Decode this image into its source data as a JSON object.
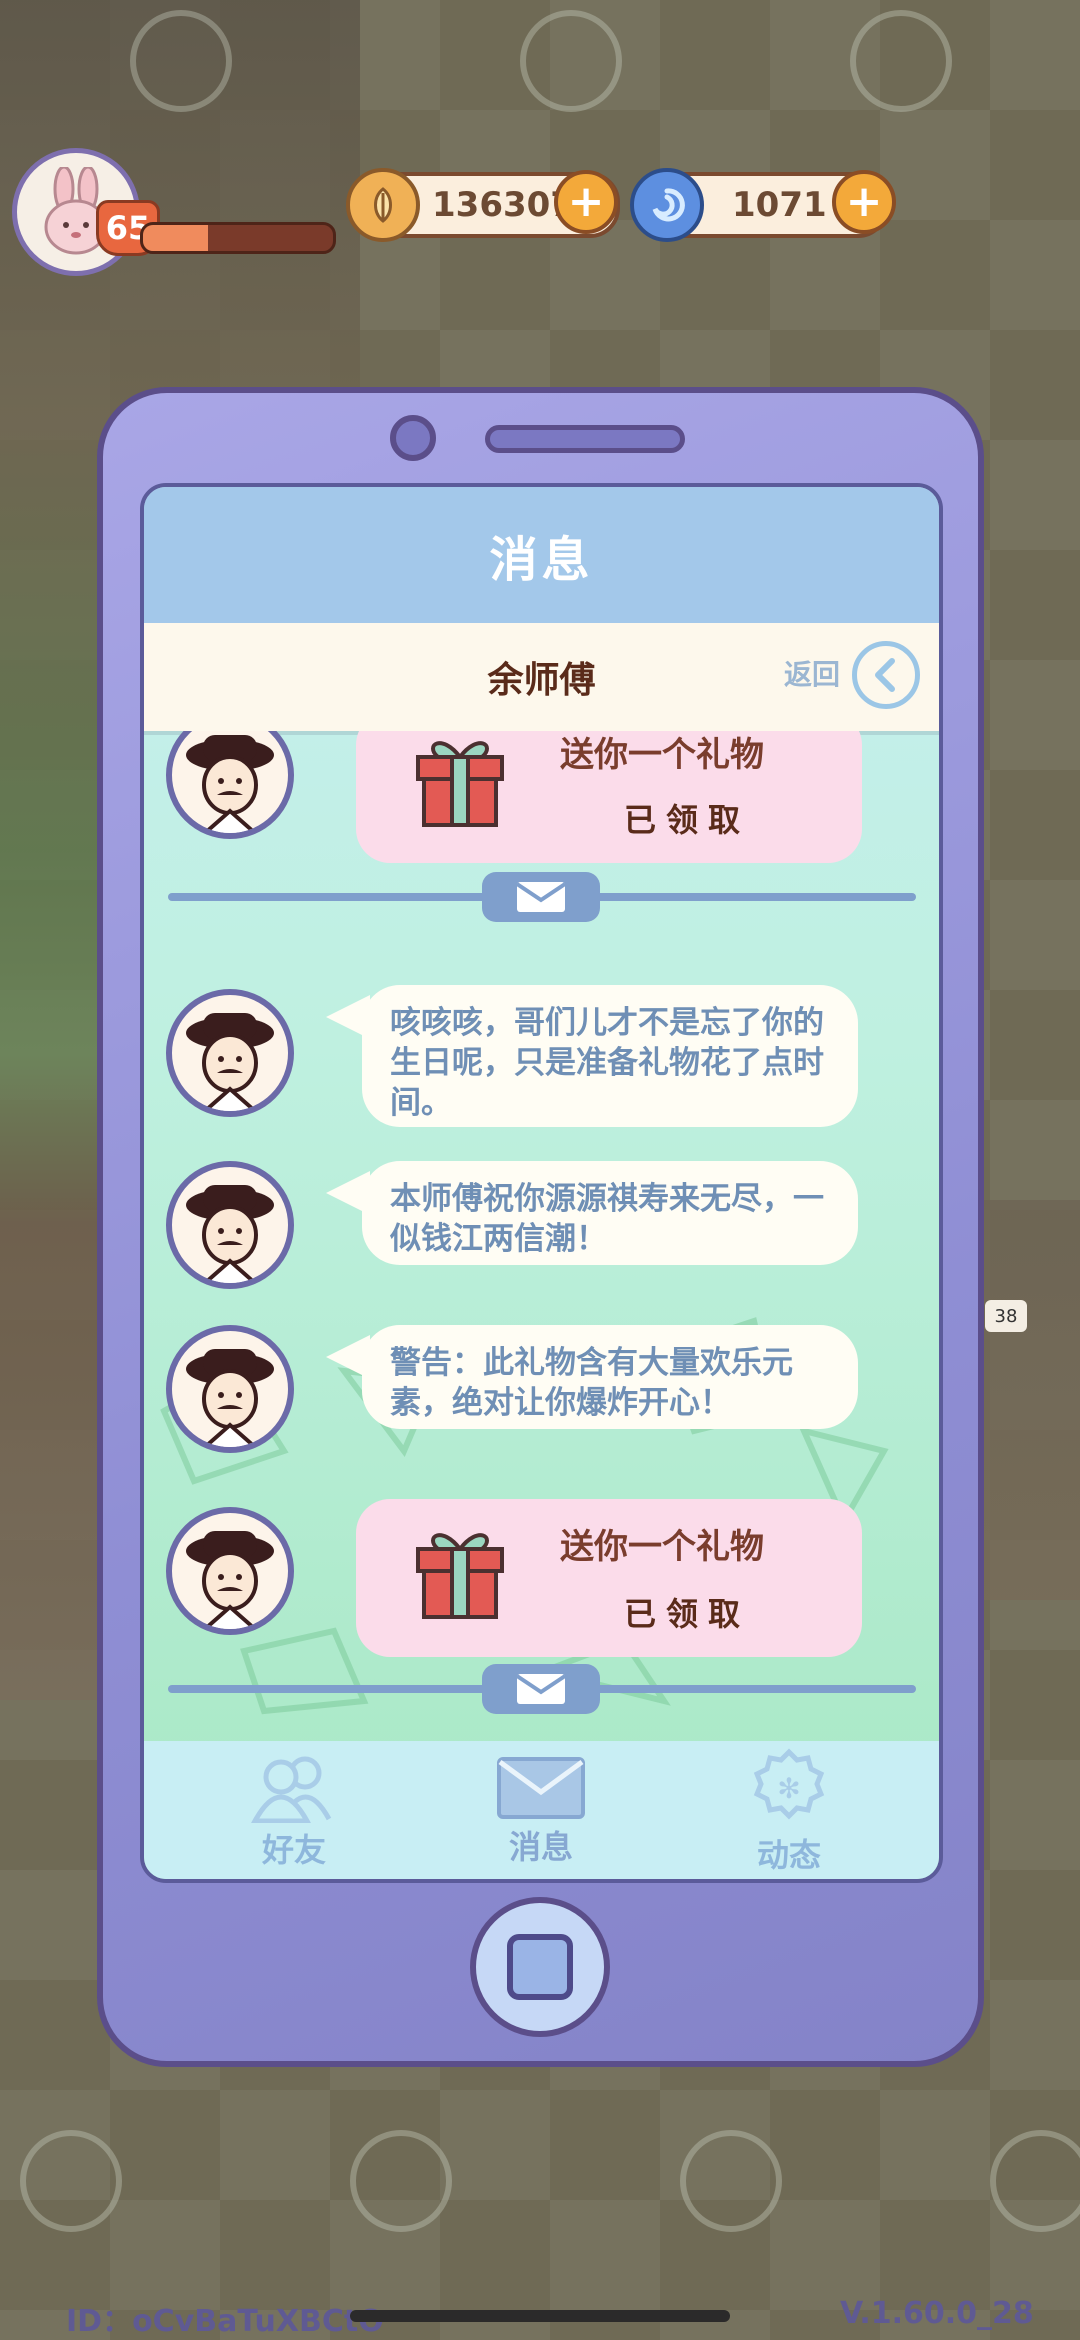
{
  "hud": {
    "level": "65",
    "xp_progress": 0.34,
    "coins": "136307",
    "gems": "1071",
    "plus_symbol": "+",
    "avatar_icon": "bunny-icon",
    "coin_icon": "leaf-coin-icon",
    "gem_icon": "swirl-gem-icon"
  },
  "phone": {
    "header_title": "消息",
    "contact_name": "余师傅",
    "back_label": "返回",
    "back_icon": "chevron-left-icon"
  },
  "messages": [
    {
      "type": "gift",
      "title": "送你一个礼物",
      "status": "已领取"
    },
    {
      "type": "text",
      "text": "咳咳咳，哥们儿才不是忘了你的生日呢，只是准备礼物花了点时间。"
    },
    {
      "type": "text",
      "text": "本师傅祝你源源祺寿来无尽，一似钱江两信潮！"
    },
    {
      "type": "text",
      "text": "警告：此礼物含有大量欢乐元素，绝对让你爆炸开心！"
    },
    {
      "type": "gift",
      "title": "送你一个礼物",
      "status": "已领取"
    }
  ],
  "tabs": [
    {
      "label": "好友",
      "icon": "friends-icon"
    },
    {
      "label": "消息",
      "icon": "envelope-icon"
    },
    {
      "label": "动态",
      "icon": "badge-icon"
    }
  ],
  "footer": {
    "id_text": "ID：oCvBaTuXBCtO",
    "version": "V.1.60.0_28"
  },
  "colors": {
    "phone_body": "#8f8ed4",
    "header": "#a3c8ea",
    "gift_card": "#fbdcea",
    "bubble_text": "#6f8fb5"
  }
}
